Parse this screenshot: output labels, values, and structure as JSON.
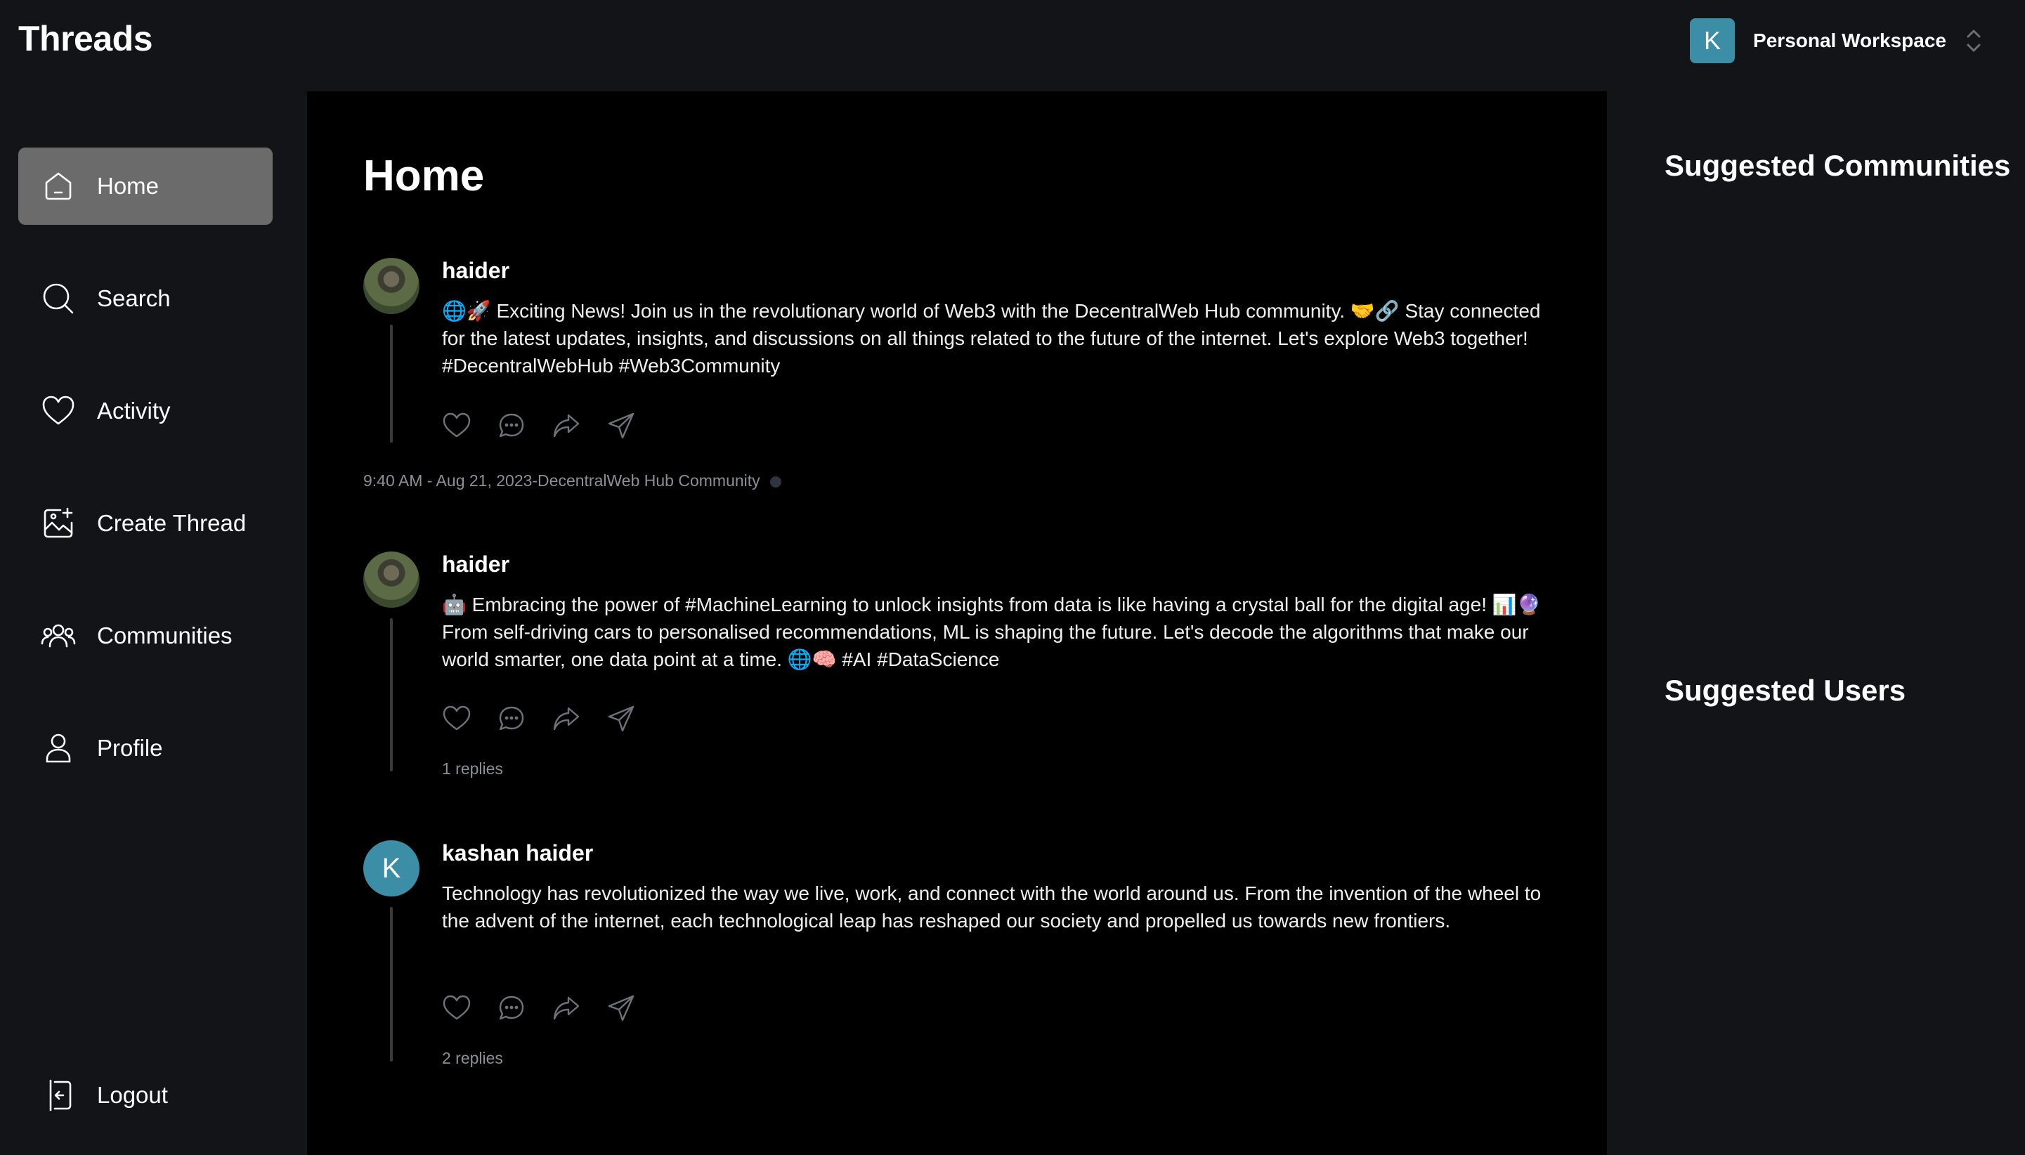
{
  "app": {
    "logo": "Threads",
    "workspace": {
      "initial": "K",
      "name": "Personal Workspace",
      "avatar_color": "#3b8ea5"
    }
  },
  "sidebar": {
    "items": [
      {
        "label": "Home",
        "icon": "home-icon",
        "active": true
      },
      {
        "label": "Search",
        "icon": "search-icon"
      },
      {
        "label": "Activity",
        "icon": "heart-icon"
      },
      {
        "label": "Create Thread",
        "icon": "create-thread-icon"
      },
      {
        "label": "Communities",
        "icon": "communities-icon"
      },
      {
        "label": "Profile",
        "icon": "profile-icon"
      }
    ],
    "logout": {
      "label": "Logout",
      "icon": "logout-icon"
    }
  },
  "main": {
    "title": "Home",
    "posts": [
      {
        "author": "haider",
        "avatar": "photo",
        "content": "🌐🚀 Exciting News! Join us in the revolutionary world of Web3 with the DecentralWeb Hub community. 🤝🔗 Stay connected for the latest updates, insights, and discussions on all things related to the future of the internet. Let's explore Web3 together! #DecentralWebHub #Web3Community",
        "meta": "9:40 AM - Aug 21, 2023-DecentralWeb Hub Community"
      },
      {
        "author": "haider",
        "avatar": "photo",
        "content": "🤖 Embracing the power of #MachineLearning to unlock insights from data is like having a crystal ball for the digital age! 📊🔮 From self-driving cars to personalised recommendations, ML is shaping the future. Let's decode the algorithms that make our world smarter, one data point at a time. 🌐🧠 #AI #DataScience",
        "replies": "1 replies"
      },
      {
        "author": "kashan haider",
        "avatar_initial": "K",
        "content": "Technology has revolutionized the way we live, work, and connect with the world around us. From the invention of the wheel to the advent of the internet, each technological leap has reshaped our society and propelled us towards new frontiers.",
        "replies": "2 replies"
      }
    ],
    "action_icons": [
      "heart-icon",
      "comment-icon",
      "repost-icon",
      "share-icon"
    ]
  },
  "rightbar": {
    "suggested_communities": "Suggested Communities",
    "suggested_users": "Suggested Users"
  },
  "colors": {
    "background": "#121417",
    "main_background": "#000000",
    "active_nav": "#6b6b6b",
    "accent": "#3b8ea5",
    "muted_text": "#8c8f97"
  }
}
